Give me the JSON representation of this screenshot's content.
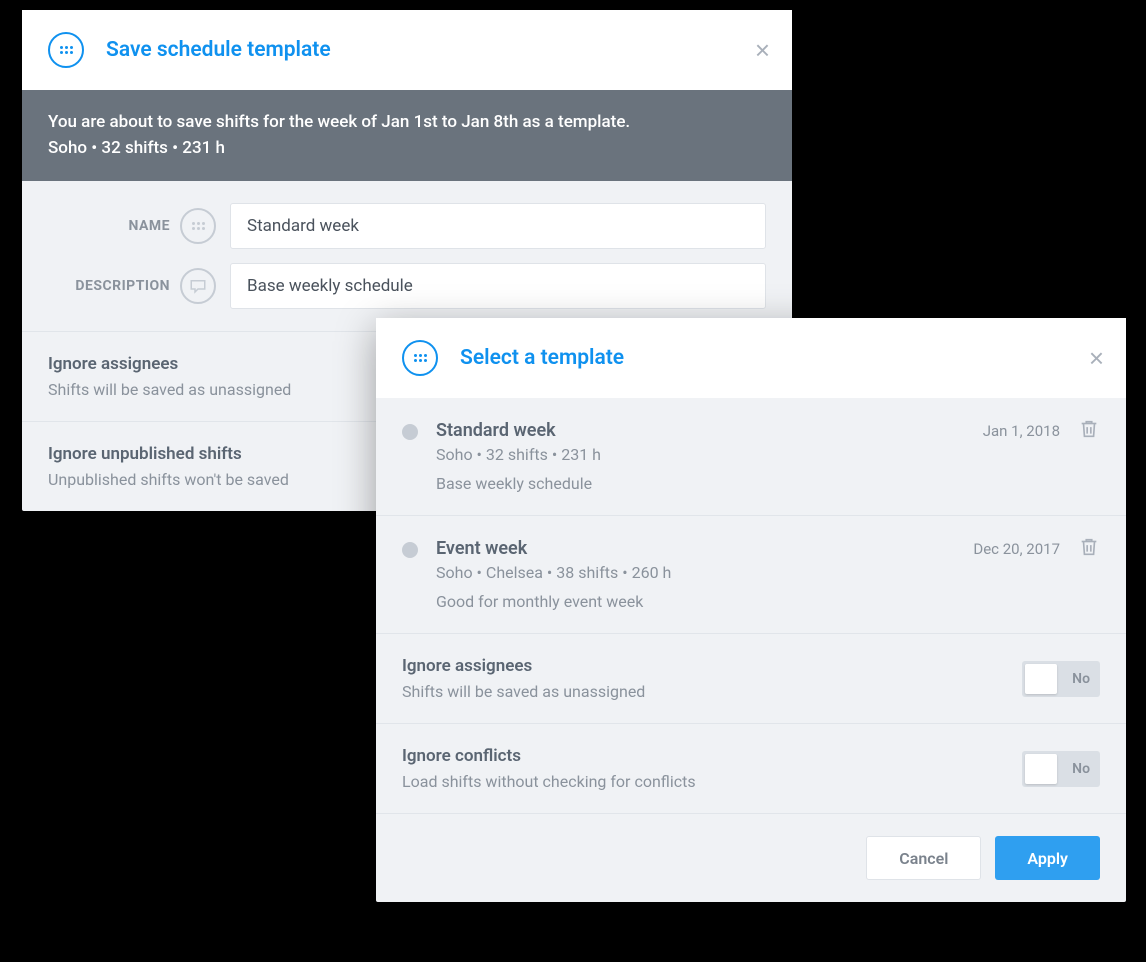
{
  "save_modal": {
    "title": "Save schedule template",
    "banner_line1": "You are about to save shifts for the week of Jan 1st to Jan 8th as a template.",
    "banner_line2": "Soho • 32 shifts • 231 h",
    "name_label": "NAME",
    "description_label": "DESCRIPTION",
    "name_value": "Standard week",
    "description_value": "Base weekly schedule",
    "options": [
      {
        "title": "Ignore assignees",
        "desc": "Shifts will be saved as unassigned"
      },
      {
        "title": "Ignore unpublished shifts",
        "desc": "Unpublished shifts won't be saved"
      }
    ]
  },
  "select_modal": {
    "title": "Select a template",
    "templates": [
      {
        "name": "Standard week",
        "meta": "Soho • 32 shifts • 231 h",
        "desc": "Base weekly schedule",
        "date": "Jan 1, 2018"
      },
      {
        "name": "Event week",
        "meta": "Soho • Chelsea • 38 shifts • 260 h",
        "desc": "Good for monthly event week",
        "date": "Dec 20, 2017"
      }
    ],
    "options": [
      {
        "title": "Ignore assignees",
        "desc": "Shifts will be saved as unassigned",
        "toggle_label": "No"
      },
      {
        "title": "Ignore conflicts",
        "desc": "Load shifts without checking for conflicts",
        "toggle_label": "No"
      }
    ],
    "cancel_label": "Cancel",
    "apply_label": "Apply"
  }
}
